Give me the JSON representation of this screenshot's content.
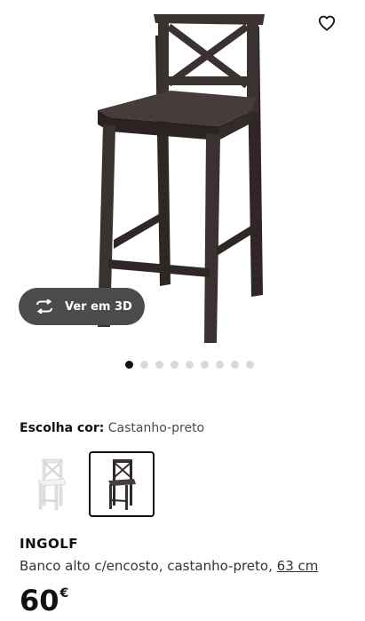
{
  "gallery": {
    "view_3d_label": "Ver em 3D",
    "image_count": 9,
    "active_index": 0
  },
  "icons": {
    "favorite": "heart-icon",
    "view_3d": "rotate-3d-icon"
  },
  "color_picker": {
    "label": "Escolha cor:",
    "selected_value": "Castanho-preto",
    "options": [
      {
        "name": "white",
        "color": "#f2f2f0",
        "selected": false
      },
      {
        "name": "castanho-preto",
        "color": "#3a3230",
        "selected": true
      }
    ]
  },
  "product": {
    "name": "INGOLF",
    "description": "Banco alto c/encosto, castanho-preto,",
    "size": "63 cm",
    "price": "60",
    "currency": "€"
  },
  "colors": {
    "wood": "#3a3230",
    "wood_dark": "#2a2322",
    "text": "#111111"
  }
}
